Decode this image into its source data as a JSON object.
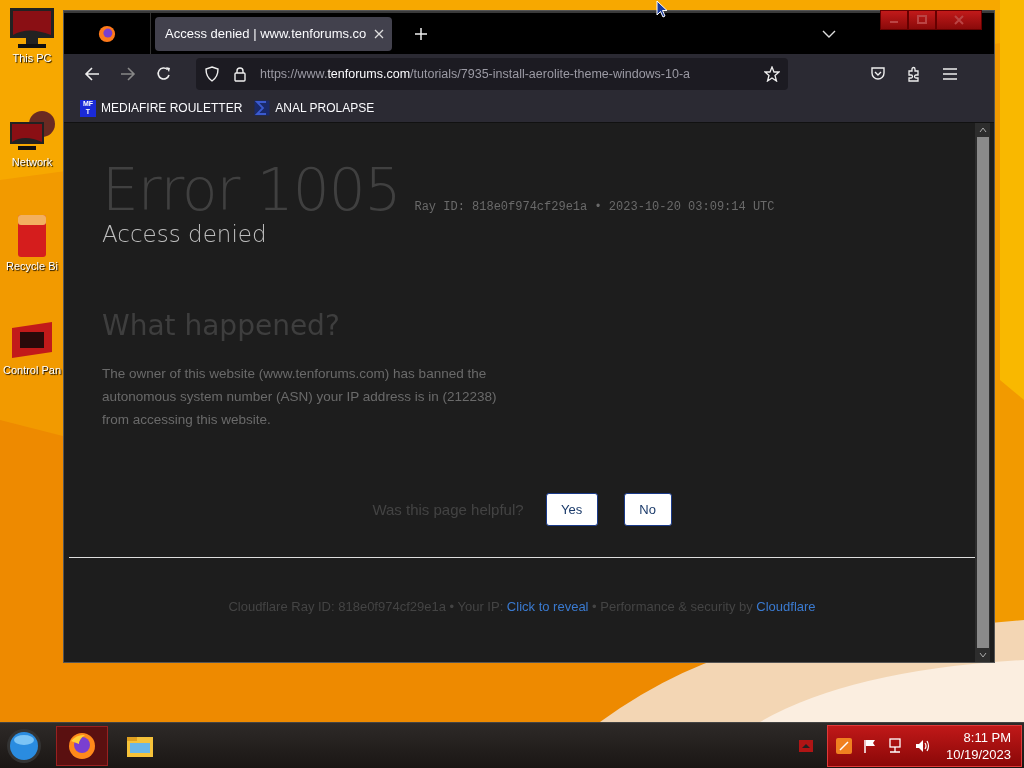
{
  "desktop_icons": [
    {
      "kind": "computer",
      "label": "This PC"
    },
    {
      "kind": "network",
      "label": "Network"
    },
    {
      "kind": "bin",
      "label": "Recycle Bi"
    },
    {
      "kind": "panel",
      "label": "Control Pan"
    }
  ],
  "browser": {
    "tabs": [
      {
        "title": "Access denied | www.tenforums.co",
        "selected": true
      }
    ],
    "url": {
      "prefix": "https://www.",
      "domain": "tenforums.com",
      "path": "/tutorials/7935-install-aerolite-theme-windows-10-a"
    },
    "bookmarks": [
      {
        "kind": "mf",
        "icon_text": [
          "MF",
          "T"
        ],
        "label": "MEDIAFIRE ROULETTER"
      },
      {
        "kind": "sigma",
        "label": "ANAL PROLAPSE"
      }
    ]
  },
  "page": {
    "error_title": "Error 1005",
    "ray_id": "Ray ID: 818e0f974cf29e1a • 2023-10-20 03:09:14 UTC",
    "subtitle": "Access denied",
    "heading": "What happened?",
    "paragraph": "The owner of this website (www.tenforums.com) has banned the autonomous system number (ASN) your IP address is in (212238) from accessing this website.",
    "feedback": {
      "question": "Was this page helpful?",
      "buttons": [
        "Yes",
        "No"
      ]
    },
    "footer": [
      {
        "kind": "text",
        "text": "Cloudflare Ray ID: 818e0f974cf29e1a • Your IP: "
      },
      {
        "kind": "link",
        "text": "Click to reveal"
      },
      {
        "kind": "text",
        "text": " • Performance & security by "
      },
      {
        "kind": "link",
        "text": "Cloudflare"
      }
    ]
  },
  "taskbar": {
    "apps": [
      {
        "kind": "firefox",
        "selected": true
      },
      {
        "kind": "explorer",
        "selected": false
      }
    ],
    "time": "8:11 PM",
    "date": "10/19/2023"
  }
}
